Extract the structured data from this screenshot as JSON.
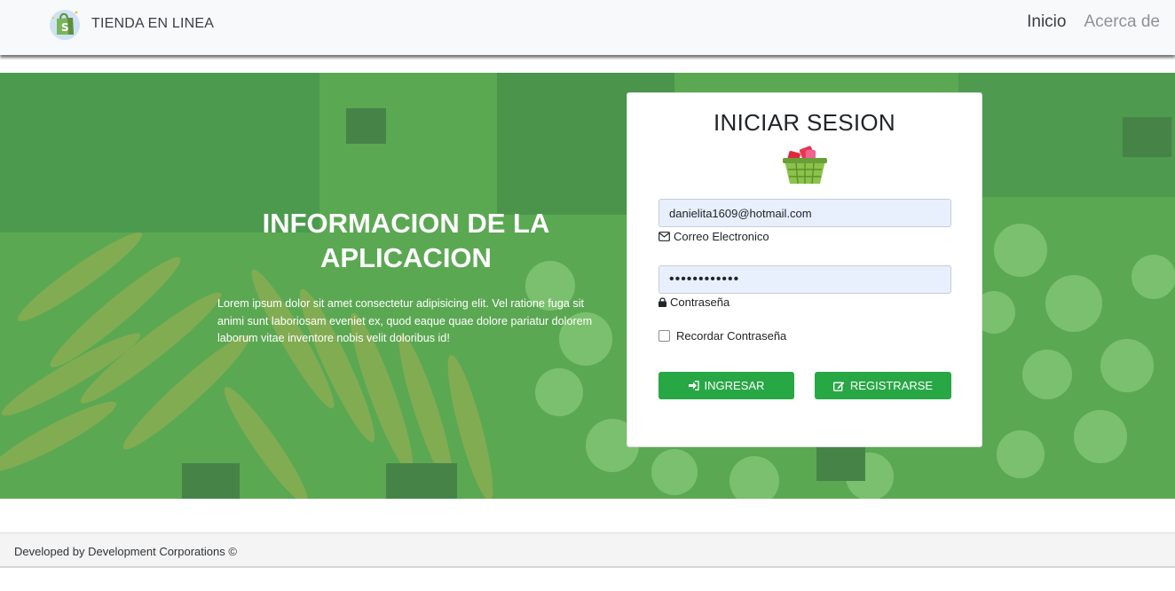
{
  "navbar": {
    "brand_text": "TIENDA EN LINEA",
    "logo_icon": "shopify-bag-icon",
    "links": [
      {
        "label": "Inicio",
        "active": true
      },
      {
        "label": "Acerca de",
        "active": false
      }
    ]
  },
  "hero": {
    "background": "vegetable-market-photo",
    "title": "INFORMACION DE LA APLICACION",
    "text": "Lorem ipsum dolor sit amet consectetur adipisicing elit. Vel ratione fuga sit animi sunt laboriosam eveniet ex, quod eaque quae dolore pariatur dolorem laborum vitae inventore nobis velit doloribus id!"
  },
  "login": {
    "title": "INICIAR SESION",
    "icon": "shopping-basket-icon",
    "email": {
      "value": "danielita1609@hotmail.com",
      "help": "Correo Electronico",
      "icon": "envelope-icon"
    },
    "password": {
      "value": "••••••••••••",
      "help": "Contraseña",
      "icon": "lock-icon"
    },
    "remember": {
      "label": "Recordar Contraseña",
      "checked": false
    },
    "buttons": {
      "login": {
        "label": "INGRESAR",
        "icon": "sign-in-icon"
      },
      "register": {
        "label": "REGISTRARSE",
        "icon": "edit-icon"
      }
    }
  },
  "footer": {
    "text": "Developed by Development Corporations ©"
  },
  "colors": {
    "accent": "#28a745",
    "hero_tint": "#58b45a",
    "input_bg": "#e8f0fe",
    "navbar_bg": "#f8f9fa"
  }
}
